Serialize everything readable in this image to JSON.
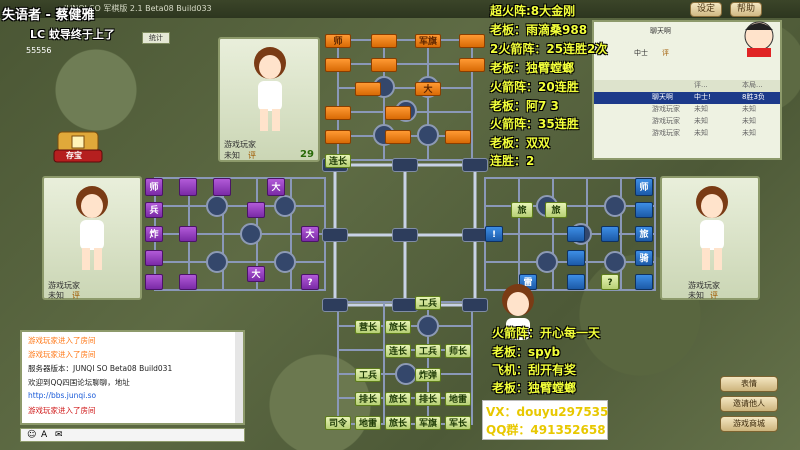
{
  "window": {
    "title": "JUNQI SO 军棋版 2.1 Beta08 Build033",
    "buttons": [
      "设定",
      "帮助"
    ]
  },
  "overlay": {
    "song": "失语者 - 蔡健雅",
    "subtitle_left": "LC 蚊导终于上了",
    "fans": [
      "超火阵:8大金刚",
      "老板：雨滴桑988",
      "2火箭阵：25连胜2次",
      "老板：独臂螳螂",
      "火箭阵：20连胜",
      "老板：阿7 3",
      "火箭阵：35连胜",
      "老板：双双",
      "连胜：2"
    ],
    "fans2": [
      "火箭阵：开心每一天",
      "老板：spyb",
      "飞机：刮开有奖",
      "老板：独臂螳螂"
    ],
    "contact": [
      "VX：douyu297535",
      "QQ群：491352658"
    ]
  },
  "left_top": {
    "id_label": "55556",
    "btn": "统计"
  },
  "players": {
    "top": {
      "name": "游戏玩家",
      "level": "未知",
      "badge": "评",
      "timer": "29"
    },
    "left": {
      "name": "游戏玩家",
      "level": "未知",
      "badge": "评"
    },
    "right": {
      "name": "游戏玩家",
      "level": "未知",
      "badge": "评"
    }
  },
  "treasure": {
    "label": "存宝"
  },
  "board": {
    "top_labels": [
      "师",
      "军旗",
      "大"
    ],
    "top_bottom_label": "连长",
    "left_labels": [
      "师",
      "兵",
      "炸",
      "大",
      "大",
      "大",
      "?"
    ],
    "right_labels": [
      "师",
      "旅",
      "旅",
      "旅",
      "!",
      "雷",
      "骑",
      "?"
    ],
    "bottom_rows": [
      [
        "工兵"
      ],
      [
        "营长",
        "旅长"
      ],
      [
        "连长",
        "工兵",
        "师长"
      ],
      [
        "工兵",
        "炸弹"
      ],
      [
        "排长",
        "旅长",
        "排长",
        "地雷"
      ],
      [
        "司令",
        "地雷",
        "旅长",
        "军旗",
        "军长"
      ]
    ]
  },
  "info_panel": {
    "header": "聊天啊",
    "rank": "中士",
    "badge": "评",
    "columns": [
      "",
      "评...",
      "本局..."
    ],
    "rows": [
      [
        "聊天啊",
        "中士!",
        "8胜3负"
      ],
      [
        "游戏玩家",
        "未知",
        "未知"
      ],
      [
        "游戏玩家",
        "未知",
        "未知"
      ],
      [
        "游戏玩家",
        "未知",
        "未知"
      ]
    ]
  },
  "chat": {
    "lines": [
      {
        "text": "游戏玩家进入了房间",
        "color": "#ff7a1a"
      },
      {
        "text": "游戏玩家进入了房间",
        "color": "#ff7a1a"
      },
      {
        "text": "服务器版本：JUNQI SO Beta08 Build031",
        "color": "#222"
      },
      {
        "text": "欢迎到QQ四国论坛聊聊，地址",
        "color": "#222"
      },
      {
        "text": "http://bbs.junqi.so",
        "color": "#1a5bd8"
      },
      {
        "text": "游戏玩家进入了房间",
        "color": "#d01a1a"
      }
    ]
  },
  "right_buttons": [
    "表情",
    "邀请他人",
    "游戏商城"
  ],
  "colors": {
    "orange": "#ff9a33",
    "purple": "#9b44c8",
    "blue": "#2c74c8",
    "green": "#b6d26a",
    "line": "#8a98b8"
  }
}
